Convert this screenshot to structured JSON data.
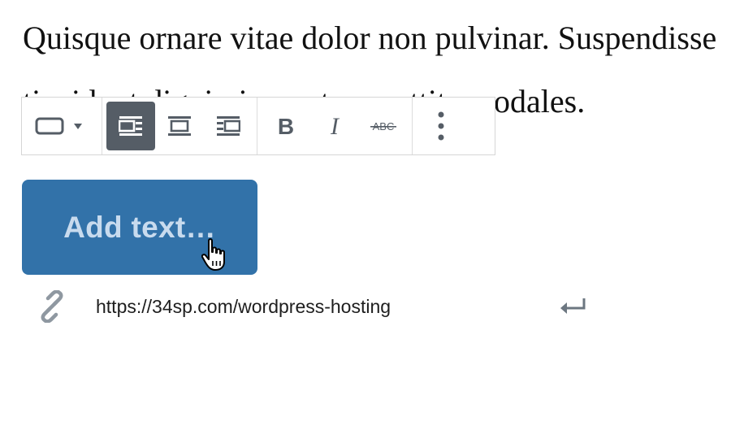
{
  "paragraph": {
    "line1": "Quisque ornare vitae dolor non pulvinar. Suspendisse",
    "line2": "tincidunt dignissim metus porttitor sodales."
  },
  "toolbar": {
    "groups": [
      {
        "items": [
          {
            "icon": "button-style-icon",
            "dropdown": true
          }
        ]
      },
      {
        "items": [
          {
            "icon": "align-left-icon",
            "active": true
          },
          {
            "icon": "align-center-icon"
          },
          {
            "icon": "align-right-icon"
          }
        ]
      },
      {
        "items": [
          {
            "icon": "bold-icon"
          },
          {
            "icon": "italic-icon"
          },
          {
            "icon": "strikethrough-icon",
            "glyph": "ABC"
          }
        ]
      },
      {
        "items": [
          {
            "icon": "more-options-icon"
          }
        ]
      }
    ]
  },
  "button_block": {
    "placeholder": "Add text…",
    "background": "#3272a9"
  },
  "link": {
    "url": "https://34sp.com/wordpress-hosting",
    "icon": "link-icon",
    "submit_icon": "enter-icon"
  },
  "colors": {
    "toolbar_icon": "#555d66",
    "active_bg": "#555d66",
    "button_text": "#c8dbee"
  }
}
